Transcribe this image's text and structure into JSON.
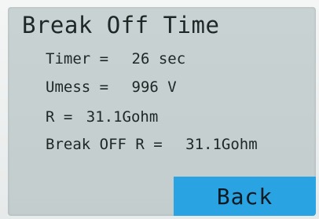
{
  "screen": {
    "title": "Break Off Time",
    "rows": {
      "timer": {
        "label": "Timer =",
        "value": "26 sec"
      },
      "umess": {
        "label": "Umess =",
        "value": "996 V"
      },
      "r": {
        "label": "R =",
        "value": "31.1Gohm"
      },
      "break_off_r": {
        "label": "Break OFF R =",
        "value": "31.1Gohm"
      }
    },
    "back_label": "Back"
  },
  "colors": {
    "screen_bg": "#c6d0d0",
    "back_button": "#2aa3e2",
    "text": "#1e2626"
  }
}
